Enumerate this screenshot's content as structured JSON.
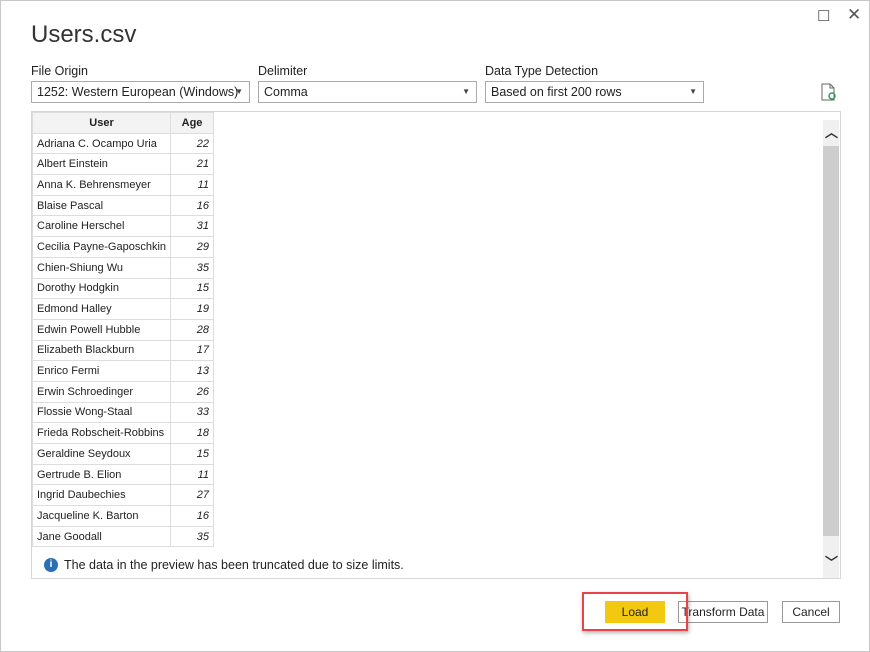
{
  "window": {
    "title": "Users.csv",
    "maximize_icon": "maximize-icon",
    "close_icon": "close-icon"
  },
  "options": {
    "file_origin": {
      "label": "File Origin",
      "value": "1252: Western European (Windows)"
    },
    "delimiter": {
      "label": "Delimiter",
      "value": "Comma"
    },
    "detection": {
      "label": "Data Type Detection",
      "value": "Based on first 200 rows"
    }
  },
  "table": {
    "headers": [
      "User",
      "Age"
    ],
    "rows": [
      [
        "Adriana C. Ocampo Uria",
        "22"
      ],
      [
        "Albert Einstein",
        "21"
      ],
      [
        "Anna K. Behrensmeyer",
        "11"
      ],
      [
        "Blaise Pascal",
        "16"
      ],
      [
        "Caroline Herschel",
        "31"
      ],
      [
        "Cecilia Payne-Gaposchkin",
        "29"
      ],
      [
        "Chien-Shiung Wu",
        "35"
      ],
      [
        "Dorothy Hodgkin",
        "15"
      ],
      [
        "Edmond Halley",
        "19"
      ],
      [
        "Edwin Powell Hubble",
        "28"
      ],
      [
        "Elizabeth Blackburn",
        "17"
      ],
      [
        "Enrico Fermi",
        "13"
      ],
      [
        "Erwin Schroedinger",
        "26"
      ],
      [
        "Flossie Wong-Staal",
        "33"
      ],
      [
        "Frieda Robscheit-Robbins",
        "18"
      ],
      [
        "Geraldine Seydoux",
        "15"
      ],
      [
        "Gertrude B. Elion",
        "11"
      ],
      [
        "Ingrid Daubechies",
        "27"
      ],
      [
        "Jacqueline K. Barton",
        "16"
      ],
      [
        "Jane Goodall",
        "35"
      ]
    ]
  },
  "info": "The data in the preview has been truncated due to size limits.",
  "buttons": {
    "load": "Load",
    "transform": "Transform Data",
    "cancel": "Cancel"
  },
  "colors": {
    "load": "#f2c811",
    "highlight": "#e8424a",
    "info": "#2a6fb3"
  }
}
